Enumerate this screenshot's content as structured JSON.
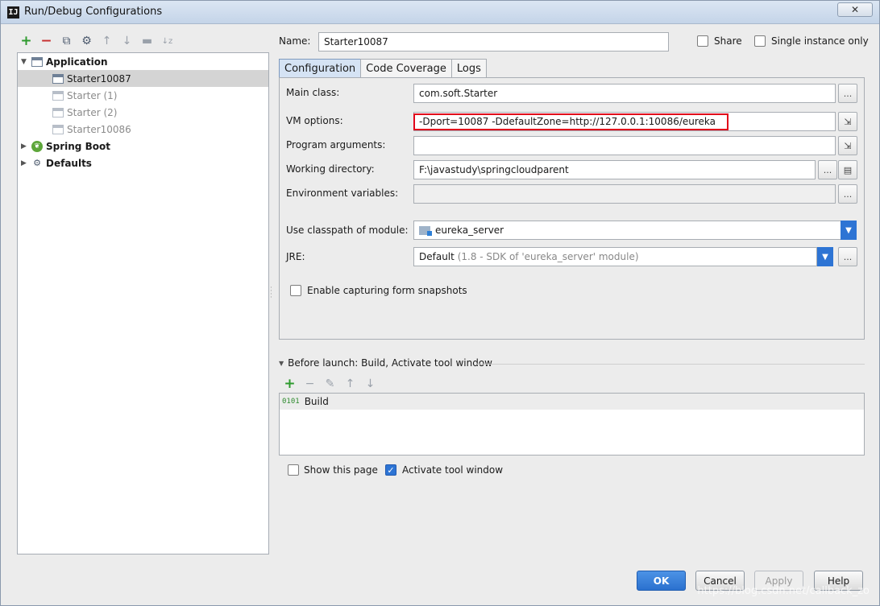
{
  "window": {
    "title": "Run/Debug Configurations",
    "close_glyph": "✕"
  },
  "left_toolbar": {
    "icons": [
      "add-icon",
      "remove-icon",
      "copy-icon",
      "wrench-icon",
      "move-up-icon",
      "move-down-icon",
      "folder-icon",
      "sort-icon"
    ],
    "add": "+",
    "remove": "−",
    "copy": "⧉",
    "wrench": "⚙",
    "up": "↑",
    "down": "↓",
    "folder": "▬",
    "sort": "↓z"
  },
  "tree": {
    "application": "Application",
    "items": [
      "Starter10087",
      "Starter (1)",
      "Starter (2)",
      "Starter10086"
    ],
    "spring_boot": "Spring Boot",
    "defaults": "Defaults"
  },
  "header": {
    "name_label": "Name:",
    "name_value": "Starter10087",
    "share_label": "Share",
    "single_instance_label": "Single instance only"
  },
  "tabs": [
    "Configuration",
    "Code Coverage",
    "Logs"
  ],
  "form": {
    "main_class_label": "Main class:",
    "main_class_value": "com.soft.Starter",
    "vm_options_label": "VM options:",
    "vm_options_value": "-Dport=10087 -DdefaultZone=http://127.0.0.1:10086/eureka",
    "program_args_label": "Program arguments:",
    "program_args_value": "",
    "working_dir_label": "Working directory:",
    "working_dir_value": "F:\\javastudy\\springcloudparent",
    "env_vars_label": "Environment variables:",
    "env_vars_value": "",
    "classpath_label": "Use classpath of module:",
    "classpath_value": "eureka_server",
    "jre_label": "JRE:",
    "jre_value": "Default",
    "jre_detail": "(1.8 - SDK of 'eureka_server' module)",
    "snapshots_label": "Enable capturing form snapshots",
    "ellipsis": "...",
    "expand_glyph": "⇲",
    "doc_glyph": "▤"
  },
  "before_launch": {
    "title": "Before launch: Build, Activate tool window",
    "item": "Build",
    "build_icon": "0101",
    "show_page_label": "Show this page",
    "activate_label": "Activate tool window"
  },
  "buttons": {
    "ok": "OK",
    "cancel": "Cancel",
    "apply": "Apply",
    "help": "Help"
  },
  "watermark": "https://blog.csdn.net/callback_zo",
  "colors": {
    "accent": "#2d74d4",
    "highlight_border": "#e1001a",
    "add_green": "#2e9a2e",
    "remove_red": "#c73030"
  }
}
